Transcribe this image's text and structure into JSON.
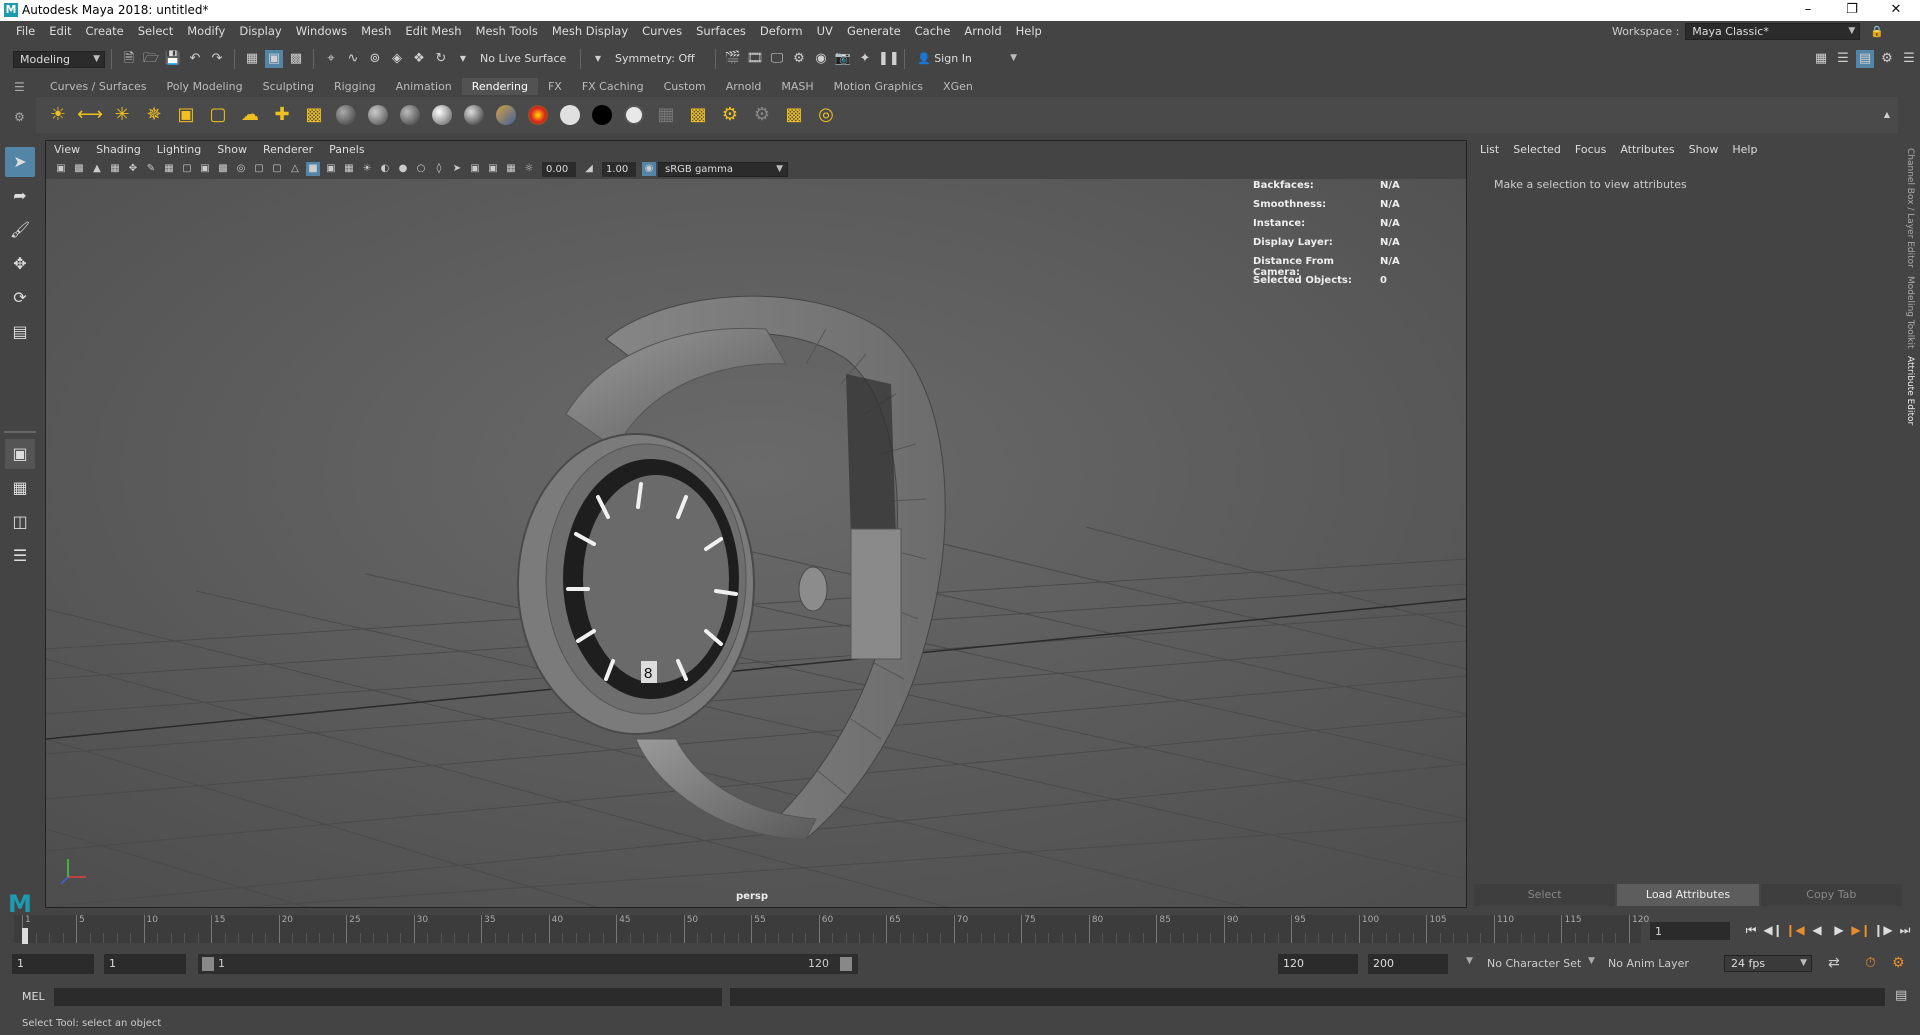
{
  "window": {
    "title": "Autodesk Maya 2018: untitled*",
    "logo": "M",
    "controls": [
      "minimize-icon",
      "restore-icon",
      "close-icon"
    ]
  },
  "menubar": {
    "items": [
      "File",
      "Edit",
      "Create",
      "Select",
      "Modify",
      "Display",
      "Windows",
      "Mesh",
      "Edit Mesh",
      "Mesh Tools",
      "Mesh Display",
      "Curves",
      "Surfaces",
      "Deform",
      "UV",
      "Generate",
      "Cache",
      "Arnold",
      "Help"
    ],
    "workspace_label": "Workspace :",
    "workspace_value": "Maya Classic*"
  },
  "statusline": {
    "menuset": "Modeling",
    "live_surface": "No Live Surface",
    "symmetry": "Symmetry: Off",
    "signin": "Sign In"
  },
  "shelf": {
    "tabs": [
      "Curves / Surfaces",
      "Poly Modeling",
      "Sculpting",
      "Rigging",
      "Animation",
      "Rendering",
      "FX",
      "FX Caching",
      "Custom",
      "Arnold",
      "MASH",
      "Motion Graphics",
      "XGen"
    ],
    "active_tab": "Rendering"
  },
  "viewport": {
    "menu": [
      "View",
      "Shading",
      "Lighting",
      "Show",
      "Renderer",
      "Panels"
    ],
    "exposure": "0.00",
    "gamma": "1.00",
    "color_space": "sRGB gamma",
    "camera": "persp",
    "hud": [
      {
        "label": "Backfaces:",
        "value": "N/A"
      },
      {
        "label": "Smoothness:",
        "value": "N/A"
      },
      {
        "label": "Instance:",
        "value": "N/A"
      },
      {
        "label": "Display Layer:",
        "value": "N/A"
      },
      {
        "label": "Distance From Camera:",
        "value": "N/A"
      },
      {
        "label": "Selected Objects:",
        "value": "0"
      }
    ],
    "dial_date": "8"
  },
  "attribute_editor": {
    "menu": [
      "List",
      "Selected",
      "Focus",
      "Attributes",
      "Show",
      "Help"
    ],
    "message": "Make a selection to view attributes",
    "buttons": [
      "Select",
      "Load Attributes",
      "Copy Tab"
    ],
    "side_tabs": [
      "Channel Box / Layer Editor",
      "Modeling Toolkit",
      "Attribute Editor"
    ]
  },
  "timeslider": {
    "ticks": [
      "1",
      "5",
      "10",
      "15",
      "20",
      "25",
      "30",
      "35",
      "40",
      "45",
      "50",
      "55",
      "60",
      "65",
      "70",
      "75",
      "80",
      "85",
      "90",
      "95",
      "100",
      "105",
      "110",
      "115",
      "120"
    ],
    "current_frame": "1"
  },
  "range": {
    "start": "1",
    "playback_start": "1",
    "slider_start": "1",
    "slider_end": "120",
    "playback_end": "120",
    "end": "200",
    "character_set": "No Character Set",
    "anim_layer": "No Anim Layer",
    "fps": "24 fps"
  },
  "commandline": {
    "label": "MEL"
  },
  "helpline": {
    "text": "Select Tool: select an object"
  }
}
